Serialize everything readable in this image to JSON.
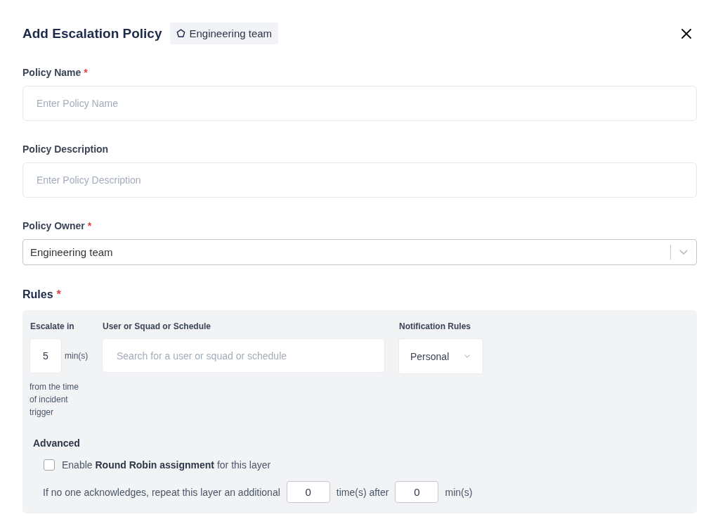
{
  "dialog": {
    "title": "Add Escalation Policy",
    "owner_badge": "Engineering team"
  },
  "required_mark": "*",
  "fields": [
    {
      "kind": "text",
      "label": "Policy Name",
      "required": true,
      "placeholder": "Enter Policy Name"
    },
    {
      "kind": "text",
      "label": "Policy Description",
      "required": false,
      "placeholder": "Enter Policy Description"
    },
    {
      "kind": "select",
      "label": "Policy Owner",
      "required": true,
      "value": "Engineering team"
    }
  ],
  "rules": {
    "label": "Rules",
    "required": true,
    "columns": [
      "Escalate in",
      "User or Squad or Schedule",
      "Notification Rules"
    ],
    "escalate_value": "5",
    "escalate_unit": "min(s)",
    "escalate_note": "from the time of incident trigger",
    "target_placeholder": "Search for a user or squad or schedule",
    "notification_value": "Personal",
    "advanced": {
      "title": "Advanced",
      "round_robin": {
        "checked": false,
        "text": "Enable **Round Robin assignment** for this layer"
      },
      "repeat": {
        "prefix": "If no one acknowledges, repeat this layer an additional",
        "times": "0",
        "middle": "time(s) after",
        "minutes": "0",
        "suffix": "min(s)"
      }
    }
  }
}
